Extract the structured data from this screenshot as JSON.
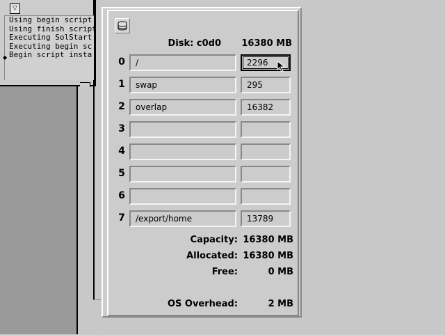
{
  "console": {
    "menu_glyph": "▽",
    "lines": [
      "Using begin script",
      "Using finish script",
      "Executing SolStart",
      "Executing begin sc",
      "Begin script insta"
    ],
    "caret": "◆"
  },
  "disk": {
    "title": "Disk: c0d0",
    "size": "16380 MB",
    "icon": "disk-stack-icon"
  },
  "slices": [
    {
      "num": "0",
      "name": "/",
      "size": "2296",
      "active": true
    },
    {
      "num": "1",
      "name": "swap",
      "size": "295"
    },
    {
      "num": "2",
      "name": "overlap",
      "size": "16382"
    },
    {
      "num": "3",
      "name": "",
      "size": ""
    },
    {
      "num": "4",
      "name": "",
      "size": ""
    },
    {
      "num": "5",
      "name": "",
      "size": ""
    },
    {
      "num": "6",
      "name": "",
      "size": ""
    },
    {
      "num": "7",
      "name": "/export/home",
      "size": "13789"
    }
  ],
  "summary": {
    "capacity_label": "Capacity:",
    "capacity_value": "16380 MB",
    "allocated_label": "Allocated:",
    "allocated_value": "16380 MB",
    "free_label": "Free:",
    "free_value": "0 MB",
    "overhead_label": "OS Overhead:",
    "overhead_value": "2 MB"
  },
  "colors": {
    "background": "#cccccc",
    "dark_strip": "#9a9a9a",
    "text": "#000000"
  }
}
